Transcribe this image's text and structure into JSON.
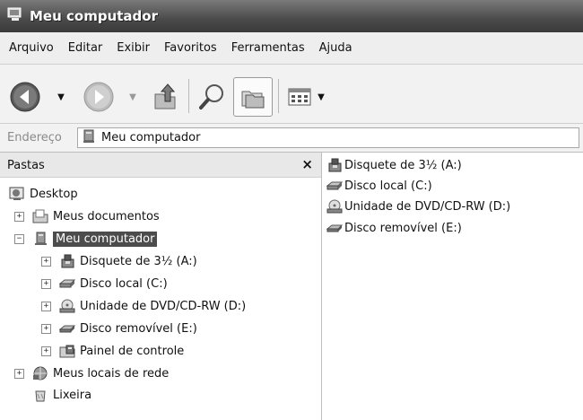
{
  "window": {
    "title": "Meu computador"
  },
  "menu": [
    "Arquivo",
    "Editar",
    "Exibir",
    "Favoritos",
    "Ferramentas",
    "Ajuda"
  ],
  "address": {
    "label": "Endereço",
    "value": "Meu computador"
  },
  "folders_pane": {
    "title": "Pastas",
    "close": "×"
  },
  "tree": [
    {
      "label": "Desktop",
      "icon": "desktop-icon"
    },
    {
      "label": "Meus documentos",
      "icon": "documents-icon"
    },
    {
      "label": "Meu computador",
      "icon": "computer-icon",
      "selected": true
    },
    {
      "label": "Disquete de 3½ (A:)",
      "icon": "floppy-icon"
    },
    {
      "label": "Disco local (C:)",
      "icon": "hard-disk-icon"
    },
    {
      "label": "Unidade de DVD/CD-RW (D:)",
      "icon": "dvd-drive-icon"
    },
    {
      "label": "Disco removível (E:)",
      "icon": "removable-disk-icon"
    },
    {
      "label": "Painel de controle",
      "icon": "control-panel-icon"
    },
    {
      "label": "Meus locais de rede",
      "icon": "network-places-icon"
    },
    {
      "label": "Lixeira",
      "icon": "recycle-bin-icon"
    }
  ],
  "expanders": {
    "plus": "+",
    "minus": "−"
  },
  "content_items": [
    {
      "label": "Disquete de 3½ (A:)",
      "icon": "floppy-icon"
    },
    {
      "label": "Disco local (C:)",
      "icon": "hard-disk-icon"
    },
    {
      "label": "Unidade de DVD/CD-RW (D:)",
      "icon": "dvd-drive-icon"
    },
    {
      "label": "Disco removível (E:)",
      "icon": "removable-disk-icon"
    }
  ]
}
